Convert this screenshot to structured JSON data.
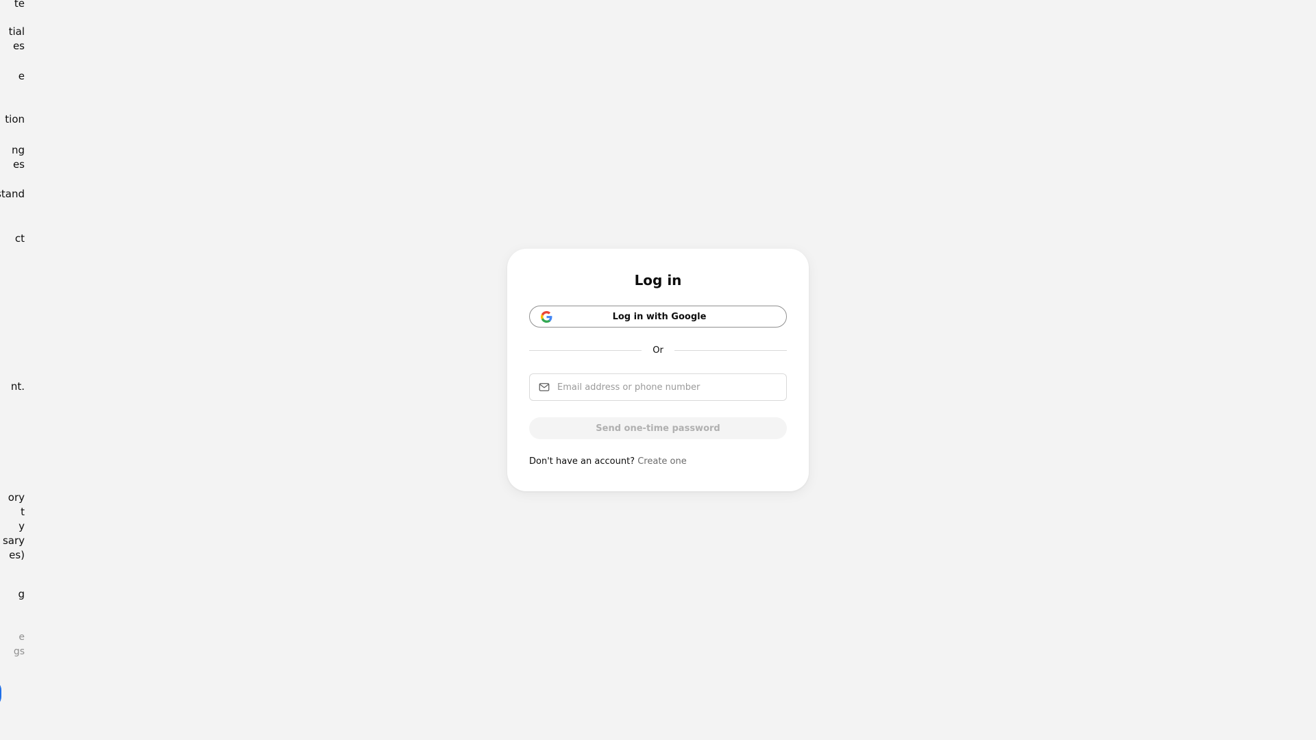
{
  "side_panel": {
    "items": [
      {
        "text": "te"
      },
      {
        "text": "tial\nes"
      },
      {
        "text": "e"
      },
      {
        "text": "\ntion"
      },
      {
        "text": "ng\nes"
      },
      {
        "text": "stand"
      },
      {
        "text": "ct"
      },
      {
        "text": "nt."
      },
      {
        "text": "\nory\nt\ny\nsary\nes)"
      },
      {
        "text": "g"
      },
      {
        "text": "e\ngs"
      }
    ]
  },
  "login": {
    "title": "Log in",
    "google_button_label": "Log in with Google",
    "divider_text": "Or",
    "email_placeholder": "Email address or phone number",
    "email_value": "",
    "otp_button_label": "Send one-time password",
    "no_account_text": "Don't have an account?",
    "create_link_label": "Create one"
  },
  "colors": {
    "background": "#f3f3f3",
    "card": "#ffffff",
    "disabled_button_bg": "#f4f4f4",
    "disabled_button_text": "#b0b0b0",
    "link_text": "#6b6b6b",
    "side_fab": "#1f6fe8"
  },
  "icons": {
    "google": "google-g-icon",
    "email": "mail-icon"
  }
}
